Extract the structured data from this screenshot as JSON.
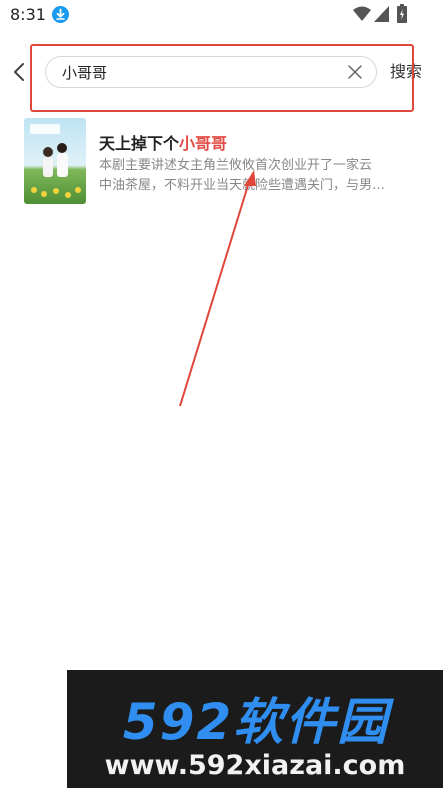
{
  "status_bar": {
    "time": "8:31",
    "icons": [
      "download-icon",
      "wifi-icon",
      "cellular-icon",
      "battery-icon"
    ]
  },
  "search": {
    "query": "小哥哥",
    "button_label": "搜索"
  },
  "results": [
    {
      "title_prefix": "天上掉下个",
      "title_keyword": "小哥哥",
      "description_line1": "本剧主要讲述女主角兰攸攸首次创业开了一家云",
      "description_line2": "中油茶屋，不料开业当天就险些遭遇关门，与男…"
    }
  ],
  "watermark": {
    "brand": "592软件园",
    "url": "www.592xiazai.com"
  },
  "colors": {
    "accent_red": "#e0473a",
    "keyword_red": "#e34b45",
    "download_blue": "#1a9bf0",
    "watermark_blue": "#2f8ef0"
  }
}
